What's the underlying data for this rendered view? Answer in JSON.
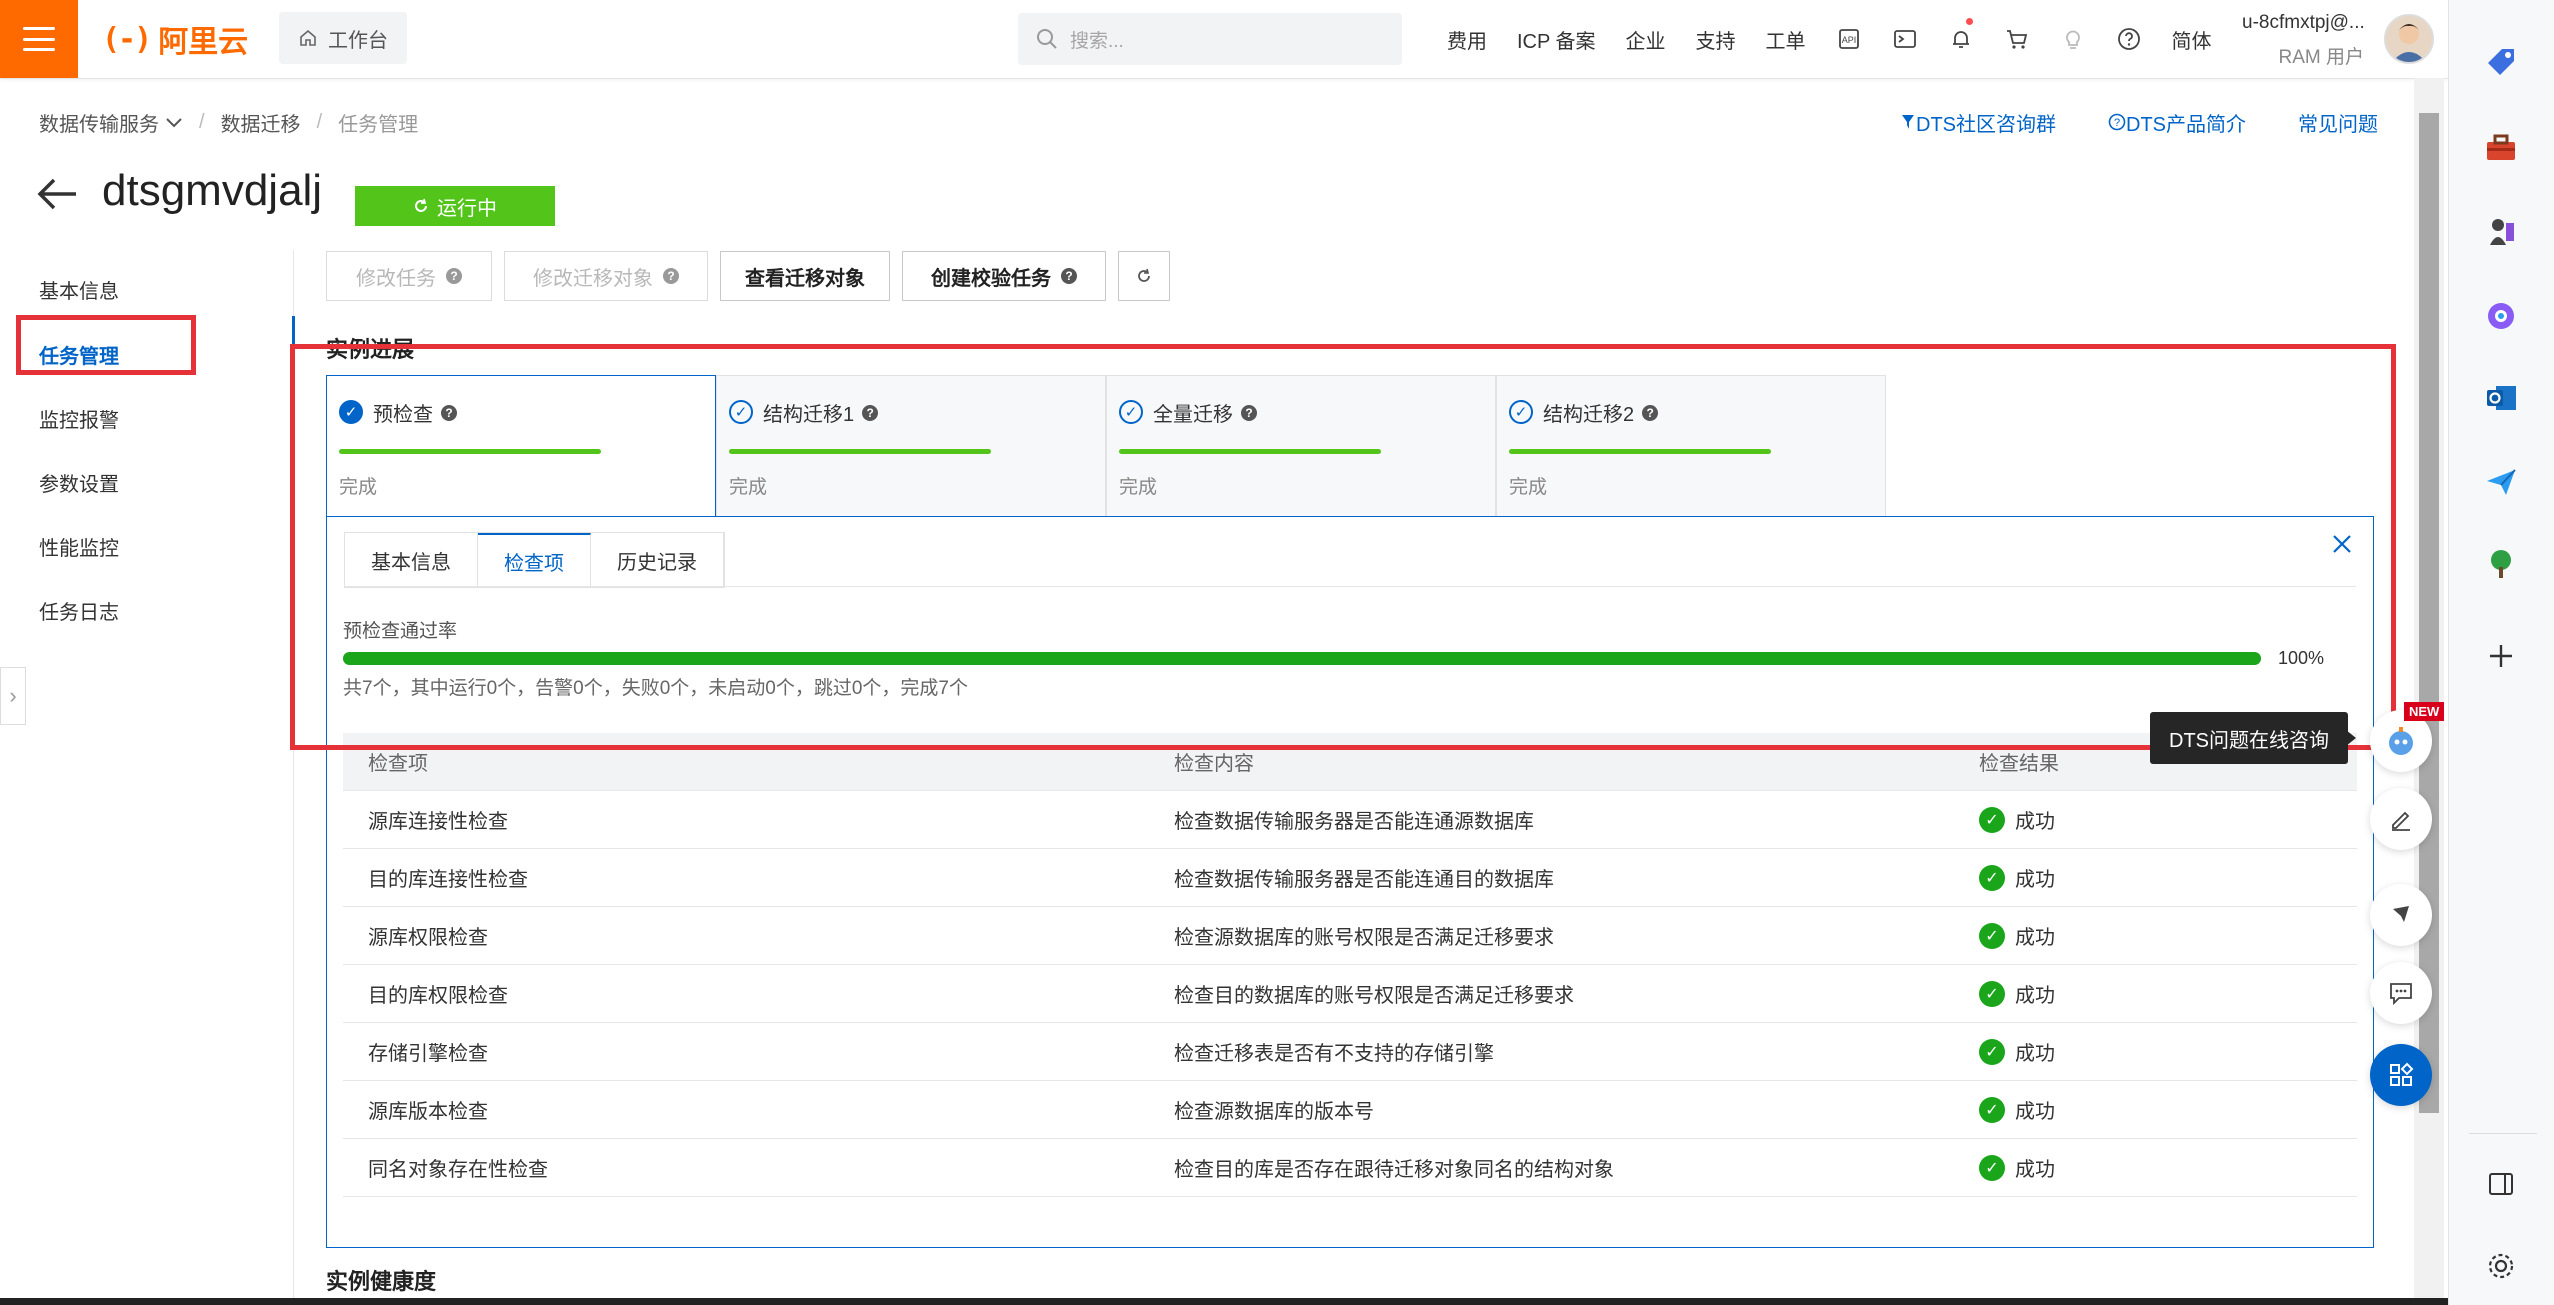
{
  "header": {
    "logo_text": "阿里云",
    "logo_mark": "(-)",
    "workbench": "工作台",
    "search_placeholder": "搜索...",
    "nav": [
      "费用",
      "ICP 备案",
      "企业",
      "支持",
      "工单"
    ],
    "lang": "简体",
    "user_name": "u-8cfmxtpj@...",
    "user_role": "RAM 用户"
  },
  "breadcrumb": [
    "数据传输服务",
    "数据迁移",
    "任务管理"
  ],
  "top_links": [
    "DTS社区咨询群",
    "DTS产品简介",
    "常见问题"
  ],
  "page": {
    "title": "dtsgmvdjalj",
    "status": "运行中"
  },
  "left_menu": [
    "基本信息",
    "任务管理",
    "监控报警",
    "参数设置",
    "性能监控",
    "任务日志"
  ],
  "actions": [
    "修改任务",
    "修改迁移对象",
    "查看迁移对象",
    "创建校验任务"
  ],
  "progress_section": {
    "title": "实例进展",
    "steps": [
      {
        "label": "预检查",
        "state": "完成"
      },
      {
        "label": "结构迁移1",
        "state": "完成"
      },
      {
        "label": "全量迁移",
        "state": "完成"
      },
      {
        "label": "结构迁移2",
        "state": "完成"
      }
    ]
  },
  "panel": {
    "tabs": [
      "基本信息",
      "检查项",
      "历史记录"
    ],
    "active_tab": 1,
    "rate_label": "预检查通过率",
    "rate_value": 100,
    "rate_text": "100%",
    "summary": "共7个，其中运行0个，告警0个，失败0个，未启动0个，跳过0个，完成7个",
    "columns": [
      "检查项",
      "检查内容",
      "检查结果"
    ],
    "rows": [
      {
        "item": "源库连接性检查",
        "content": "检查数据传输服务器是否能连通源数据库",
        "result": "成功"
      },
      {
        "item": "目的库连接性检查",
        "content": "检查数据传输服务器是否能连通目的数据库",
        "result": "成功"
      },
      {
        "item": "源库权限检查",
        "content": "检查源数据库的账号权限是否满足迁移要求",
        "result": "成功"
      },
      {
        "item": "目的库权限检查",
        "content": "检查目的数据库的账号权限是否满足迁移要求",
        "result": "成功"
      },
      {
        "item": "存储引擎检查",
        "content": "检查迁移表是否有不支持的存储引擎",
        "result": "成功"
      },
      {
        "item": "源库版本检查",
        "content": "检查源数据库的版本号",
        "result": "成功"
      },
      {
        "item": "同名对象存在性检查",
        "content": "检查目的库是否存在跟待迁移对象同名的结构对象",
        "result": "成功"
      }
    ]
  },
  "health_title": "实例健康度",
  "tooltip": "DTS问题在线咨询",
  "new_badge": "NEW",
  "colors": {
    "brand": "#ff6a00",
    "link": "#0064c8",
    "success": "#1aa51a",
    "running": "#52c41a",
    "highlight": "#e53238"
  }
}
